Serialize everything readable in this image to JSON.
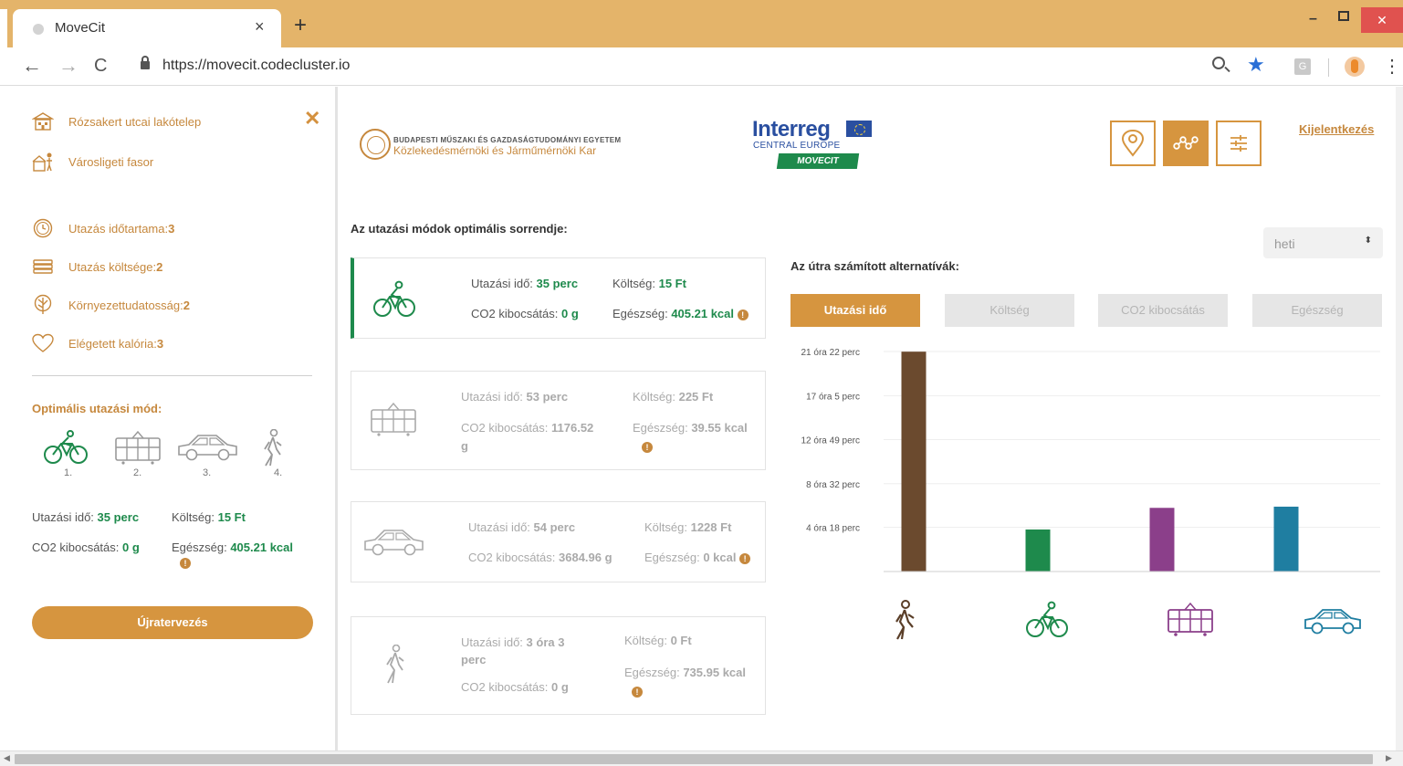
{
  "browser": {
    "tab_title": "MoveCit",
    "tab_close": "×",
    "new_tab": "+",
    "url": "https://movecit.codecluster.io",
    "ext_label": "G",
    "back": "←",
    "forward": "→",
    "reload": "C",
    "min": "–",
    "close": "✕",
    "menu": "⋮",
    "star": "★"
  },
  "sidebar": {
    "close": "✕",
    "origin": "Rózsakert utcai lakótelep",
    "destination": "Városligeti fasor",
    "priorities": [
      {
        "label": "Utazás időtartama: ",
        "value": "3",
        "icon": "clock-icon"
      },
      {
        "label": "Utazás költsége: ",
        "value": "2",
        "icon": "money-icon"
      },
      {
        "label": "Környezettudatosság: ",
        "value": "2",
        "icon": "tree-icon"
      },
      {
        "label": "Elégetett kalória: ",
        "value": "3",
        "icon": "heart-icon"
      }
    ],
    "optimal_heading": "Optimális utazási mód:",
    "mode_order": [
      "1.",
      "2.",
      "3.",
      "4."
    ],
    "summary": {
      "time_label": "Utazási idő: ",
      "time_value": "35 perc",
      "cost_label": "Költség: ",
      "cost_value": "15 Ft",
      "co2_label": "CO2 kibocsátás: ",
      "co2_value": "0 g",
      "health_label": "Egészség: ",
      "health_value": "405.21 kcal"
    },
    "replan_button": "Újratervezés"
  },
  "header": {
    "bme_line1": "BUDAPESTI MŰSZAKI ÉS GAZDASÁGTUDOMÁNYI EGYETEM",
    "bme_line2": "Közlekedésmérnöki és Járműmérnöki Kar",
    "interreg": "Interreg",
    "central_europe": "CENTRAL EUROPE",
    "movecit": "MOVECIT",
    "logout": "Kijelentkezés"
  },
  "ranking": {
    "title": "Az utazási módok optimális sorrendje:",
    "labels": {
      "time": "Utazási idő: ",
      "cost": "Költség: ",
      "co2": "CO2 kibocsátás: ",
      "health": "Egészség: "
    },
    "cards": [
      {
        "mode": "bicycle",
        "time": "35 perc",
        "cost": "15 Ft",
        "co2": "0 g",
        "health": "405.21 kcal"
      },
      {
        "mode": "tram",
        "time": "53 perc",
        "cost": "225 Ft",
        "co2": "1176.52 g",
        "health": "39.55 kcal"
      },
      {
        "mode": "car",
        "time": "54 perc",
        "cost": "1228 Ft",
        "co2": "3684.96 g",
        "health": "0 kcal"
      },
      {
        "mode": "walk",
        "time": "3 óra 3 perc",
        "cost": "0 Ft",
        "co2": "0 g",
        "health": "735.95 kcal"
      }
    ]
  },
  "alternatives": {
    "title": "Az útra számított alternatívák:",
    "period": "heti",
    "period_arrow": "⬍",
    "tabs": [
      "Utazási idő",
      "Költség",
      "CO2 kibocsátás",
      "Egészség"
    ]
  },
  "chart_data": {
    "type": "bar",
    "title": "",
    "xlabel": "",
    "ylabel": "",
    "categories": [
      "gyalog",
      "kerékpár",
      "villamos",
      "autó"
    ],
    "values_minutes": [
      1281,
      245,
      371,
      378
    ],
    "colors": [
      "#6b4a2e",
      "#1e8a4c",
      "#8b3f8a",
      "#1f7ea1"
    ],
    "y_ticks_minutes": [
      258,
      512,
      769,
      1025,
      1282
    ],
    "y_tick_labels": [
      "4 óra 18 perc",
      "8 óra 32 perc",
      "12 óra 49 perc",
      "17 óra 5 perc",
      "21 óra 22 perc"
    ],
    "ylim_minutes": [
      0,
      1282
    ],
    "grid": true
  }
}
